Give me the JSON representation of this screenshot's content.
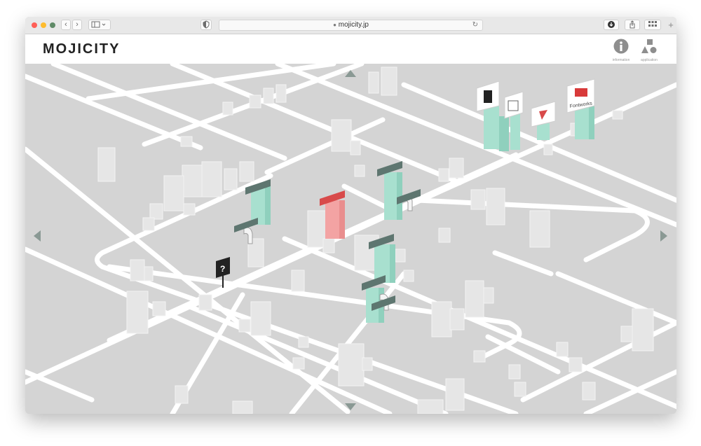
{
  "browser": {
    "url": "mojicity.jp"
  },
  "header": {
    "logo": "MOJICITY",
    "info_label": "information",
    "app_label": "application"
  },
  "map": {
    "signs": {
      "question": "?",
      "fontworks": "Fontworks"
    },
    "building_colors": {
      "active": "#a8e0cf",
      "highlight": "#f3a3a3",
      "neutral": "#e6e6e6"
    }
  }
}
